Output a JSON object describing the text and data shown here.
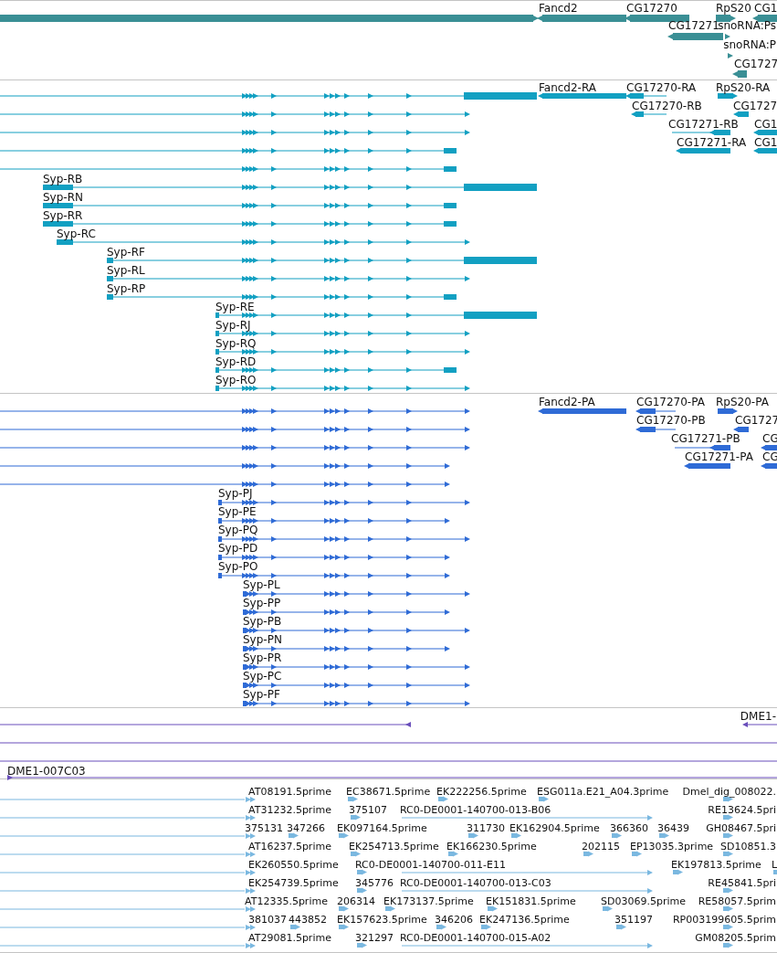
{
  "tracks": [
    {
      "kind": "gene",
      "labels": [
        "Fancd2",
        "CG17270",
        "RpS20",
        "CG1",
        "CG17271",
        "snoRNA:Ps",
        "snoRNA:P",
        "CG1727"
      ]
    },
    {
      "kind": "transcript",
      "labels": [
        "Fancd2-RA",
        "CG17270-RA",
        "RpS20-RA",
        "CG17270-RB",
        "CG1727",
        "CG17271-RB",
        "CG1",
        "CG17271-RA",
        "CG1",
        "Syp-RB",
        "Syp-RN",
        "Syp-RR",
        "Syp-RC",
        "Syp-RF",
        "Syp-RL",
        "Syp-RP",
        "Syp-RE",
        "Syp-RJ",
        "Syp-RQ",
        "Syp-RD",
        "Syp-RO"
      ]
    },
    {
      "kind": "protein",
      "labels": [
        "Fancd2-PA",
        "CG17270-PA",
        "RpS20-PA",
        "CG17270-PB",
        "CG1727",
        "CG17271-PB",
        "CG",
        "CG17271-PA",
        "CG",
        "Syp-PJ",
        "Syp-PE",
        "Syp-PQ",
        "Syp-PD",
        "Syp-PO",
        "Syp-PL",
        "Syp-PP",
        "Syp-PB",
        "Syp-PN",
        "Syp-PR",
        "Syp-PC",
        "Syp-PF"
      ]
    },
    {
      "kind": "clone",
      "labels": [
        "DME1-",
        "DME1-007C03"
      ]
    },
    {
      "kind": "est",
      "labels": [
        "AT08191.5prime",
        "EC38671.5prime",
        "EK222256.5prime",
        "ESG011a.E21_A04.3prime",
        "Dmel_dig_008022.",
        "AT31232.5prime",
        "375107",
        "RC0-DE0001-140700-013-B06",
        "RE13624.5pri",
        "375131",
        "347266",
        "EK097164.5prime",
        "311730",
        "EK162904.5prime",
        "366360",
        "36439",
        "GH08467.5pri",
        "AT16237.5prime",
        "EK254713.5prime",
        "EK166230.5prime",
        "202115",
        "EP13035.3prime",
        "SD10851.3",
        "EK260550.5prime",
        "RC0-DE0001-140700-011-E11",
        "EK197813.5prime",
        "L",
        "EK254739.5prime",
        "345776",
        "RC0-DE0001-140700-013-C03",
        "RE45841.5pri",
        "AT12335.5prime",
        "206314",
        "EK173137.5prime",
        "EK151831.5prime",
        "SD03069.5prime",
        "RE58057.5prim",
        "381037",
        "443852",
        "EK157623.5prime",
        "346206",
        "EK247136.5prime",
        "351197",
        "RP003199605.5prim",
        "AT29081.5prime",
        "321297",
        "RC0-DE0001-140700-015-A02",
        "GM08205.5prim"
      ]
    }
  ]
}
